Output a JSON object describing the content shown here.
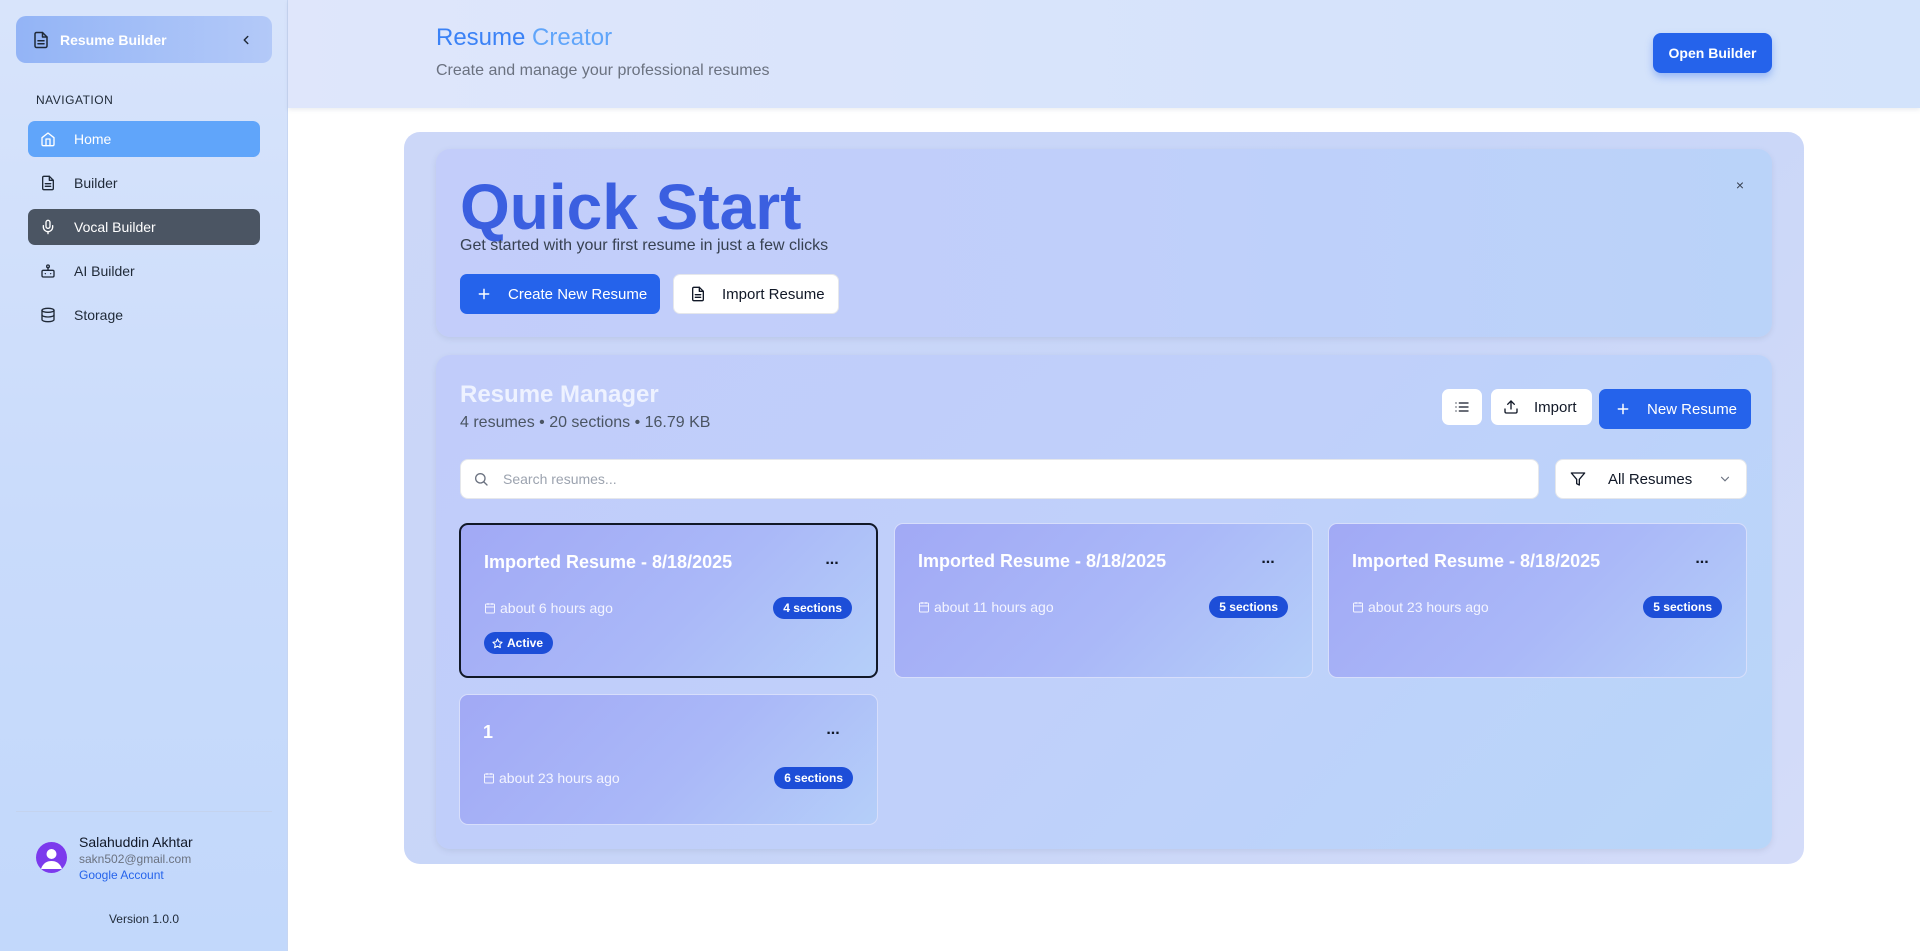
{
  "sidebar": {
    "brand": "Resume Builder",
    "nav_heading": "NAVIGATION",
    "items": [
      {
        "label": "Home",
        "icon": "home-icon"
      },
      {
        "label": "Builder",
        "icon": "file-icon"
      },
      {
        "label": "Vocal Builder",
        "icon": "mic-icon"
      },
      {
        "label": "AI Builder",
        "icon": "bot-icon"
      },
      {
        "label": "Storage",
        "icon": "database-icon"
      }
    ],
    "user": {
      "name": "Salahuddin Akhtar",
      "email": "sakn502@gmail.com",
      "account": "Google Account"
    },
    "version": "Version 1.0.0"
  },
  "header": {
    "title_part1": "Resume ",
    "title_part2": "Creator",
    "subtitle": "Create and manage your professional resumes",
    "open_builder": "Open Builder"
  },
  "quick_start": {
    "title": "Quick Start",
    "subtitle": "Get started with your first resume in just a few clicks",
    "close": "×",
    "create": "Create New Resume",
    "import": "Import Resume"
  },
  "manager": {
    "title": "Resume Manager",
    "stats": "4 resumes • 20 sections • 16.79 KB",
    "import": "Import",
    "new": "New Resume",
    "search_placeholder": "Search resumes...",
    "filter": "All Resumes",
    "cards": [
      {
        "title": "Imported Resume - 8/18/2025",
        "time": "about 6 hours ago",
        "sections": "4 sections",
        "active": "Active"
      },
      {
        "title": "Imported Resume - 8/18/2025",
        "time": "about 11 hours ago",
        "sections": "5 sections"
      },
      {
        "title": "Imported Resume - 8/18/2025",
        "time": "about 23 hours ago",
        "sections": "5 sections"
      },
      {
        "title": "1",
        "time": "about 23 hours ago",
        "sections": "6 sections"
      }
    ],
    "menu": "..."
  },
  "colors": {
    "accent": "#2563eb",
    "active_nav": "#60a5fa",
    "dark_nav": "#4b5563",
    "quick_title": "#3b5fe0"
  }
}
